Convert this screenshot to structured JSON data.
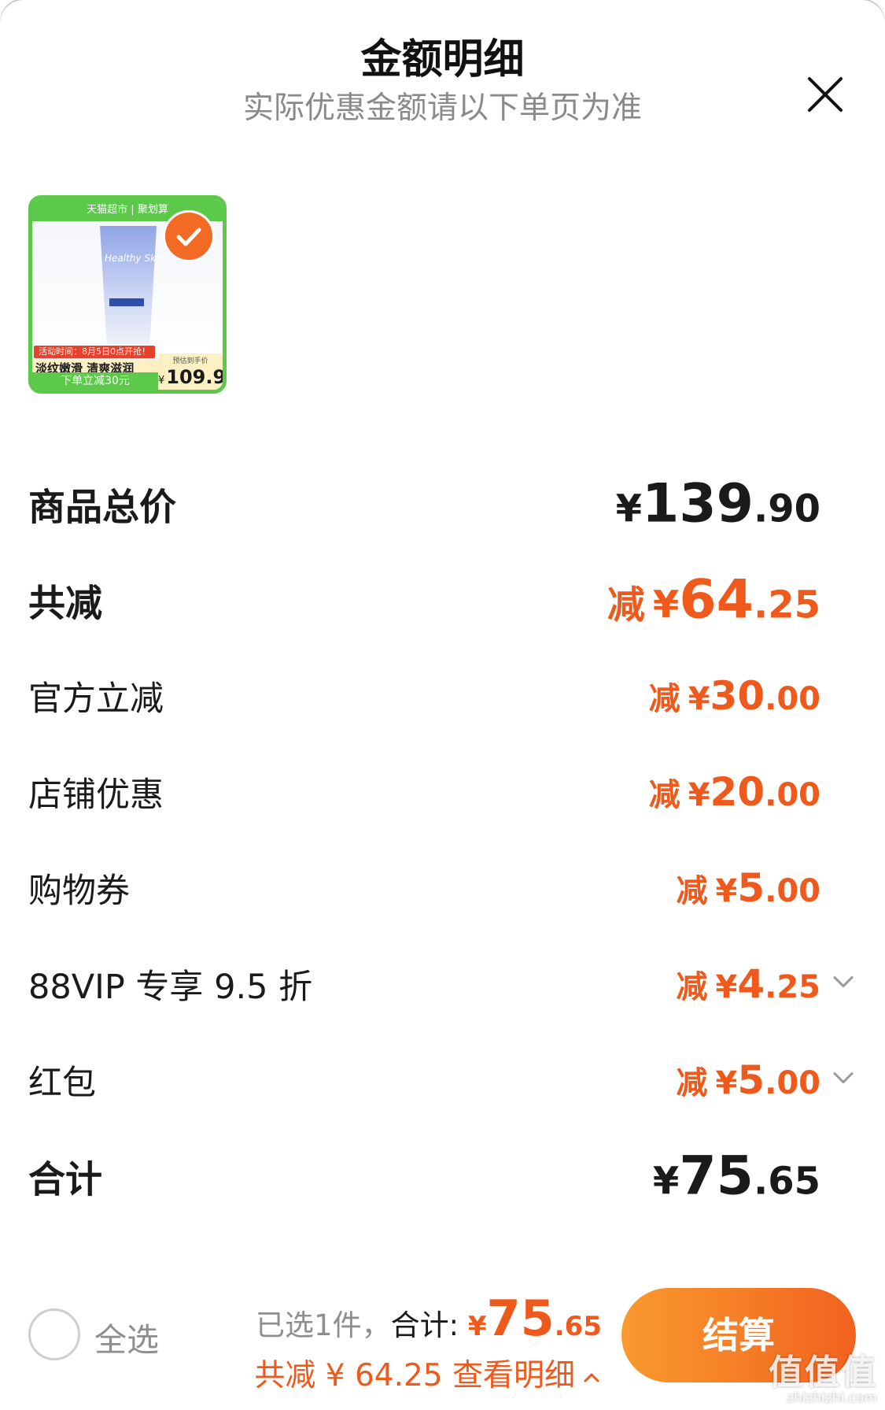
{
  "header": {
    "title": "金额明细",
    "subtitle": "实际优惠金额请以下单页为准"
  },
  "product": {
    "top_banner": "天猫超市 | 聚划算",
    "tube_brand": "Healthy Skin",
    "activity": "活动时间：8月5日0点开抢！",
    "slogan": "淡纹嫩滑 清爽滋润",
    "bottom_text": "下单立减30元",
    "price_label": "预估到手价",
    "price_symbol": "¥",
    "price": "109.9",
    "selected": true
  },
  "rows": [
    {
      "label": "商品总价",
      "prefix": "",
      "yen": "¥",
      "int": "139",
      "dec": ".90",
      "color": "#1a1a1a",
      "emphasis": true
    },
    {
      "label": "共减",
      "prefix": "减",
      "yen": "¥",
      "int": "64",
      "dec": ".25",
      "color": "#ef5a1c",
      "emphasis": true
    },
    {
      "label": "官方立减",
      "prefix": "减",
      "yen": "¥",
      "int": "30",
      "dec": ".00",
      "color": "#ef5a1c"
    },
    {
      "label": "店铺优惠",
      "prefix": "减",
      "yen": "¥",
      "int": "20",
      "dec": ".00",
      "color": "#ef5a1c"
    },
    {
      "label": "购物券",
      "prefix": "减",
      "yen": "¥",
      "int": "5",
      "dec": ".00",
      "color": "#ef5a1c"
    },
    {
      "label": "88VIP 专享 9.5 折",
      "prefix": "减",
      "yen": "¥",
      "int": "4",
      "dec": ".25",
      "color": "#ef5a1c",
      "expandable": true
    },
    {
      "label": "红包",
      "prefix": "减",
      "yen": "¥",
      "int": "5",
      "dec": ".00",
      "color": "#ef5a1c",
      "expandable": true
    },
    {
      "label": "合计",
      "prefix": "",
      "yen": "¥",
      "int": "75",
      "dec": ".65",
      "color": "#1a1a1a",
      "emphasis": true
    }
  ],
  "bottom_bar": {
    "select_all_label": "全选",
    "selected_count_text": "已选1件，",
    "total_label": "合计: ",
    "total_yen": "¥",
    "total_int": "75",
    "total_dec": ".65",
    "saved_text": "共减 ¥ 64.25 查看明细",
    "checkout_label": "结算"
  },
  "watermark": {
    "main": "值值值",
    "sub": "zhizhizhi.com"
  },
  "icons": {
    "close": "close-icon",
    "check": "check-icon",
    "chevron_down": "chevron-down-icon",
    "chevron_up": "chevron-up-icon"
  },
  "colors": {
    "accent": "#ef5a1c",
    "checkout_gradient_start": "#f99a2e",
    "checkout_gradient_end": "#f2621f",
    "product_frame": "#5cc94b"
  }
}
